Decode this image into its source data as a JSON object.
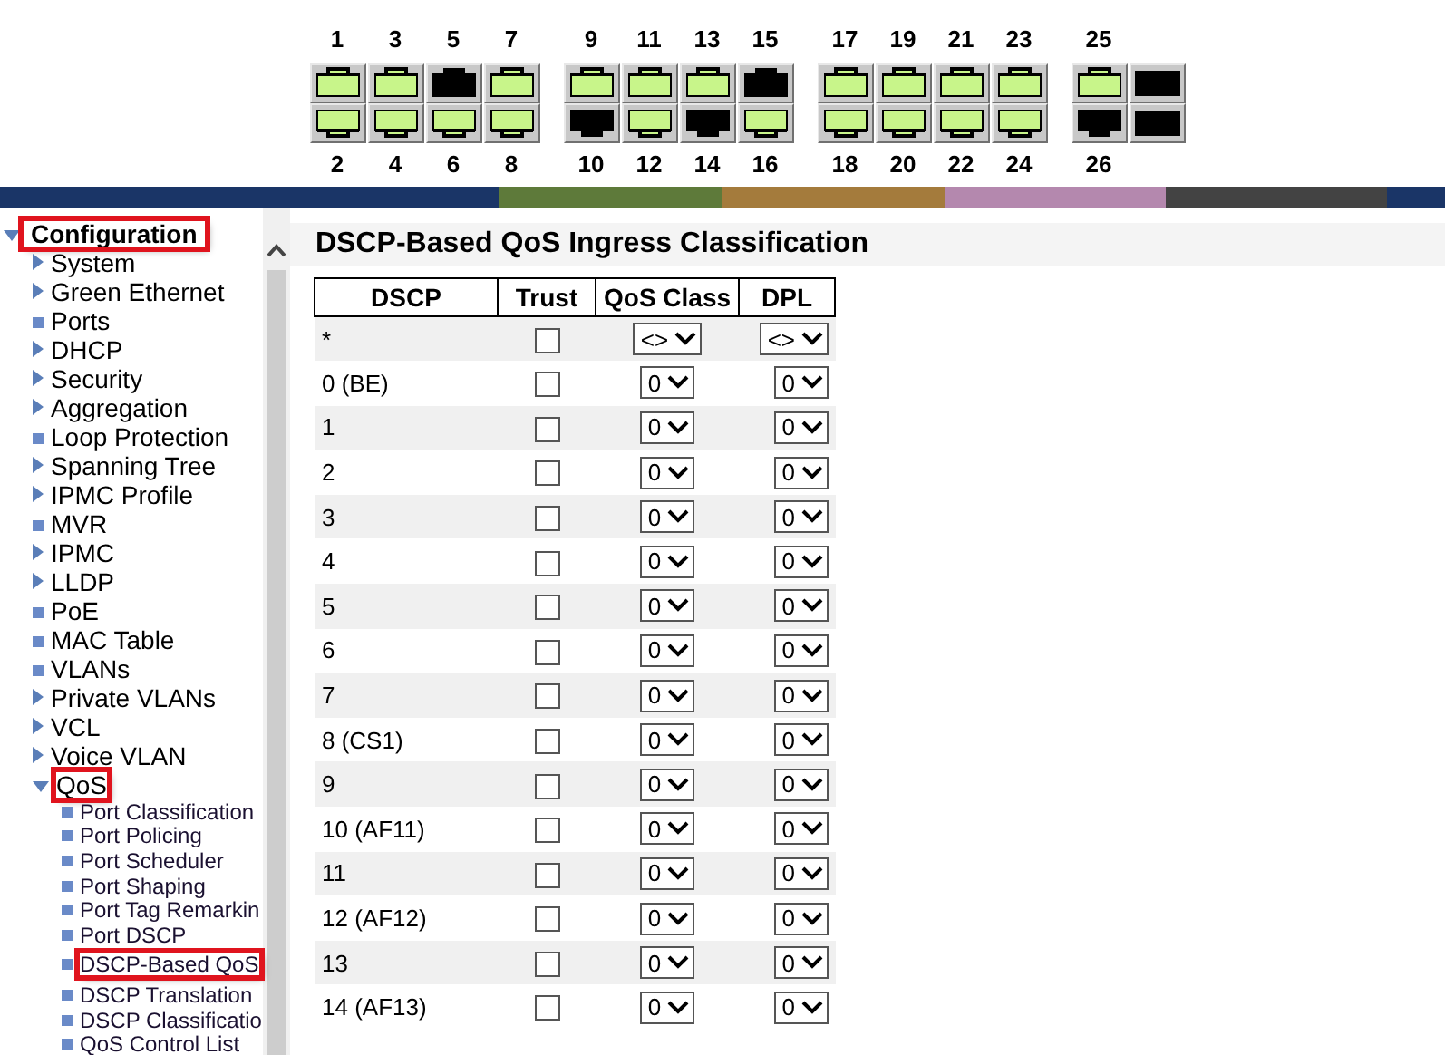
{
  "port_groups": [
    {
      "columns": [
        {
          "top": {
            "label": "1",
            "linked": true
          },
          "bottom": {
            "label": "2",
            "linked": true
          }
        },
        {
          "top": {
            "label": "3",
            "linked": true
          },
          "bottom": {
            "label": "4",
            "linked": true
          }
        },
        {
          "top": {
            "label": "5",
            "linked": false
          },
          "bottom": {
            "label": "6",
            "linked": true
          }
        },
        {
          "top": {
            "label": "7",
            "linked": true
          },
          "bottom": {
            "label": "8",
            "linked": true
          }
        }
      ]
    },
    {
      "columns": [
        {
          "top": {
            "label": "9",
            "linked": true
          },
          "bottom": {
            "label": "10",
            "linked": false
          }
        },
        {
          "top": {
            "label": "11",
            "linked": true
          },
          "bottom": {
            "label": "12",
            "linked": true
          }
        },
        {
          "top": {
            "label": "13",
            "linked": true
          },
          "bottom": {
            "label": "14",
            "linked": false
          }
        },
        {
          "top": {
            "label": "15",
            "linked": false
          },
          "bottom": {
            "label": "16",
            "linked": true
          }
        }
      ]
    },
    {
      "columns": [
        {
          "top": {
            "label": "17",
            "linked": true
          },
          "bottom": {
            "label": "18",
            "linked": true
          }
        },
        {
          "top": {
            "label": "19",
            "linked": true
          },
          "bottom": {
            "label": "20",
            "linked": true
          }
        },
        {
          "top": {
            "label": "21",
            "linked": true
          },
          "bottom": {
            "label": "22",
            "linked": true
          }
        },
        {
          "top": {
            "label": "23",
            "linked": true
          },
          "bottom": {
            "label": "24",
            "linked": true
          }
        }
      ]
    },
    {
      "columns": [
        {
          "top": {
            "label": "25",
            "linked": true
          },
          "bottom": {
            "label": "26",
            "linked": false
          }
        },
        {
          "top": {
            "linked": false,
            "kind": "sfp"
          },
          "bottom": {
            "linked": false,
            "kind": "sfp"
          }
        }
      ]
    }
  ],
  "sidebar": {
    "root": {
      "label": "Configuration",
      "expanded": true,
      "highlighted": true
    },
    "items": [
      {
        "label": "System",
        "kind": "folder",
        "expanded": false,
        "highlighted": false
      },
      {
        "label": "Green Ethernet",
        "kind": "folder",
        "expanded": false,
        "highlighted": false
      },
      {
        "label": "Ports",
        "kind": "page",
        "highlighted": false
      },
      {
        "label": "DHCP",
        "kind": "folder",
        "expanded": false,
        "highlighted": false
      },
      {
        "label": "Security",
        "kind": "folder",
        "expanded": false,
        "highlighted": false
      },
      {
        "label": "Aggregation",
        "kind": "folder",
        "expanded": false,
        "highlighted": false
      },
      {
        "label": "Loop Protection",
        "kind": "page",
        "highlighted": false
      },
      {
        "label": "Spanning Tree",
        "kind": "folder",
        "expanded": false,
        "highlighted": false
      },
      {
        "label": "IPMC Profile",
        "kind": "folder",
        "expanded": false,
        "highlighted": false
      },
      {
        "label": "MVR",
        "kind": "page",
        "highlighted": false
      },
      {
        "label": "IPMC",
        "kind": "folder",
        "expanded": false,
        "highlighted": false
      },
      {
        "label": "LLDP",
        "kind": "folder",
        "expanded": false,
        "highlighted": false
      },
      {
        "label": "PoE",
        "kind": "page",
        "highlighted": false
      },
      {
        "label": "MAC Table",
        "kind": "page",
        "highlighted": false
      },
      {
        "label": "VLANs",
        "kind": "page",
        "highlighted": false
      },
      {
        "label": "Private VLANs",
        "kind": "folder",
        "expanded": false,
        "highlighted": false
      },
      {
        "label": "VCL",
        "kind": "folder",
        "expanded": false,
        "highlighted": false
      },
      {
        "label": "Voice VLAN",
        "kind": "folder",
        "expanded": false,
        "highlighted": false
      },
      {
        "label": "QoS",
        "kind": "folder",
        "expanded": true,
        "highlighted": true,
        "children": [
          {
            "label": "Port Classification",
            "kind": "page",
            "highlighted": false
          },
          {
            "label": "Port Policing",
            "kind": "page",
            "highlighted": false
          },
          {
            "label": "Port Scheduler",
            "kind": "page",
            "highlighted": false
          },
          {
            "label": "Port Shaping",
            "kind": "page",
            "highlighted": false
          },
          {
            "label": "Port Tag Remarkin",
            "kind": "page",
            "highlighted": false
          },
          {
            "label": "Port DSCP",
            "kind": "page",
            "highlighted": false
          },
          {
            "label": "DSCP-Based QoS",
            "kind": "page",
            "highlighted": true
          },
          {
            "label": "DSCP Translation",
            "kind": "page",
            "highlighted": false
          },
          {
            "label": "DSCP Classificatio",
            "kind": "page",
            "highlighted": false
          },
          {
            "label": "QoS Control List",
            "kind": "page",
            "highlighted": false
          }
        ]
      }
    ]
  },
  "main": {
    "title": "DSCP-Based QoS Ingress Classification",
    "table": {
      "columns": [
        "DSCP",
        "Trust",
        "QoS Class",
        "DPL"
      ],
      "rows": [
        {
          "dscp": "*",
          "trust": false,
          "qos_class": "<>",
          "dpl": "<>"
        },
        {
          "dscp": "0 (BE)",
          "trust": false,
          "qos_class": "0",
          "dpl": "0"
        },
        {
          "dscp": "1",
          "trust": false,
          "qos_class": "0",
          "dpl": "0"
        },
        {
          "dscp": "2",
          "trust": false,
          "qos_class": "0",
          "dpl": "0"
        },
        {
          "dscp": "3",
          "trust": false,
          "qos_class": "0",
          "dpl": "0"
        },
        {
          "dscp": "4",
          "trust": false,
          "qos_class": "0",
          "dpl": "0"
        },
        {
          "dscp": "5",
          "trust": false,
          "qos_class": "0",
          "dpl": "0"
        },
        {
          "dscp": "6",
          "trust": false,
          "qos_class": "0",
          "dpl": "0"
        },
        {
          "dscp": "7",
          "trust": false,
          "qos_class": "0",
          "dpl": "0"
        },
        {
          "dscp": "8 (CS1)",
          "trust": false,
          "qos_class": "0",
          "dpl": "0"
        },
        {
          "dscp": "9",
          "trust": false,
          "qos_class": "0",
          "dpl": "0"
        },
        {
          "dscp": "10 (AF11)",
          "trust": false,
          "qos_class": "0",
          "dpl": "0"
        },
        {
          "dscp": "11",
          "trust": false,
          "qos_class": "0",
          "dpl": "0"
        },
        {
          "dscp": "12 (AF12)",
          "trust": false,
          "qos_class": "0",
          "dpl": "0"
        },
        {
          "dscp": "13",
          "trust": false,
          "qos_class": "0",
          "dpl": "0"
        },
        {
          "dscp": "14 (AF13)",
          "trust": false,
          "qos_class": "0",
          "dpl": "0"
        }
      ]
    }
  }
}
